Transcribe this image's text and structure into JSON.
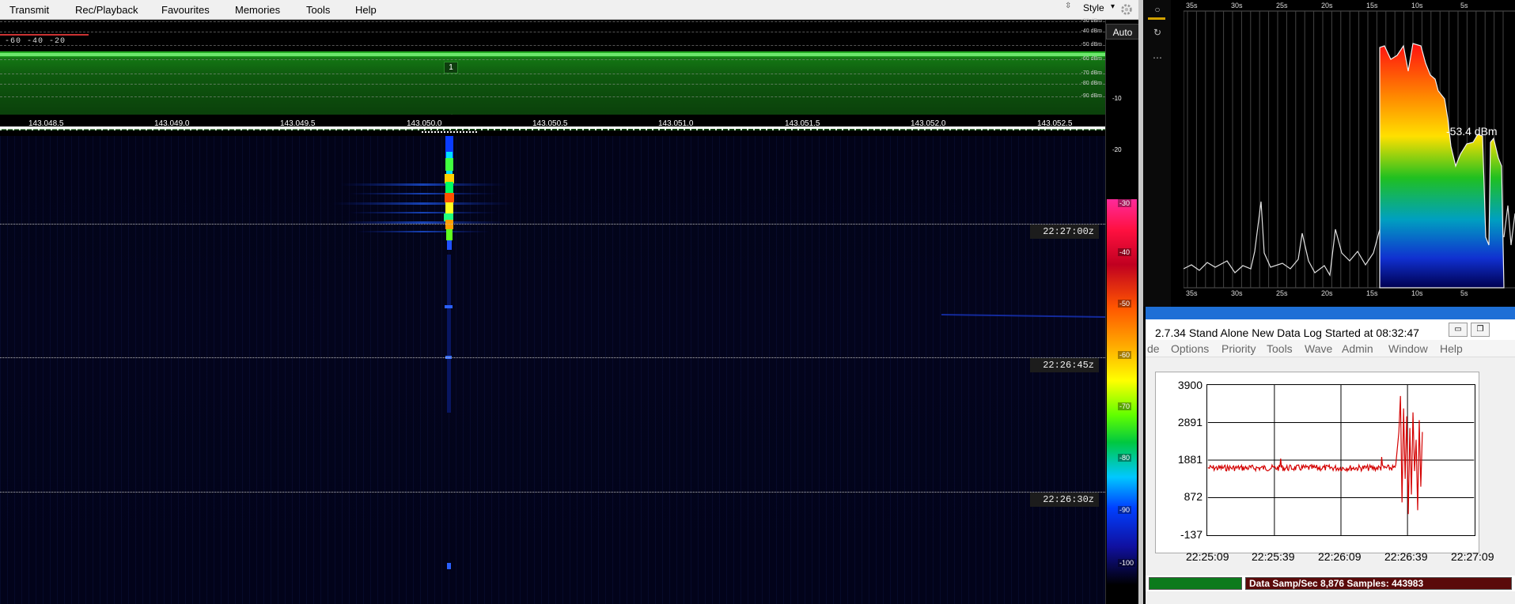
{
  "menu": {
    "items": [
      "Transmit",
      "Rec/Playback",
      "Favourites",
      "Memories",
      "Tools",
      "Help"
    ],
    "style_label": "Style"
  },
  "spectrum": {
    "range_labels": "-60  -40  -20",
    "marker": "1",
    "dbm_labels": [
      "-30 dBm",
      "-40 dBm",
      "-50 dBm",
      "-60 dBm",
      "-70 dBm",
      "-80 dBm",
      "-90 dBm"
    ]
  },
  "freq_axis": {
    "ticks": [
      "143.048.5",
      "143.049.0",
      "143.049.5",
      "143.050.0",
      "143.050.5",
      "143.051.0",
      "143.051.5",
      "143.052.0",
      "143.052.5"
    ]
  },
  "waterfall": {
    "times": [
      "22:27:00z",
      "22:26:45z",
      "22:26:30z"
    ]
  },
  "scale": {
    "auto_label": "Auto",
    "top_labels": [
      "-10",
      "-20"
    ],
    "colorbar_labels": [
      "-30",
      "-40",
      "-50",
      "-60",
      "-70",
      "-80",
      "-90",
      "-100"
    ]
  },
  "analyzer": {
    "time_ticks": [
      "35s",
      "30s",
      "25s",
      "20s",
      "15s",
      "10s",
      "5s"
    ],
    "dbm_readout": "-53.4 dBm"
  },
  "datalog": {
    "title": "2.7.34   Stand Alone   New Data Log Started at 08:32:47",
    "menu": [
      "de",
      "Options",
      "Priority",
      "Tools",
      "Wave",
      "Admin",
      "Window",
      "Help"
    ],
    "y_labels": [
      "3900",
      "2891",
      "1881",
      "872",
      "-137"
    ],
    "x_labels": [
      "22:25:09",
      "22:25:39",
      "22:26:09",
      "22:26:39",
      "22:27:09"
    ],
    "status": "Data Samp/Sec 8,876   Samples:  443983",
    "trace_color": "#d40000"
  },
  "colors": {
    "accent_gold": "#d2a200",
    "title_blue": "#1e6fd6",
    "status_red": "#5a0a0a",
    "status_green": "#0c7a1c"
  }
}
